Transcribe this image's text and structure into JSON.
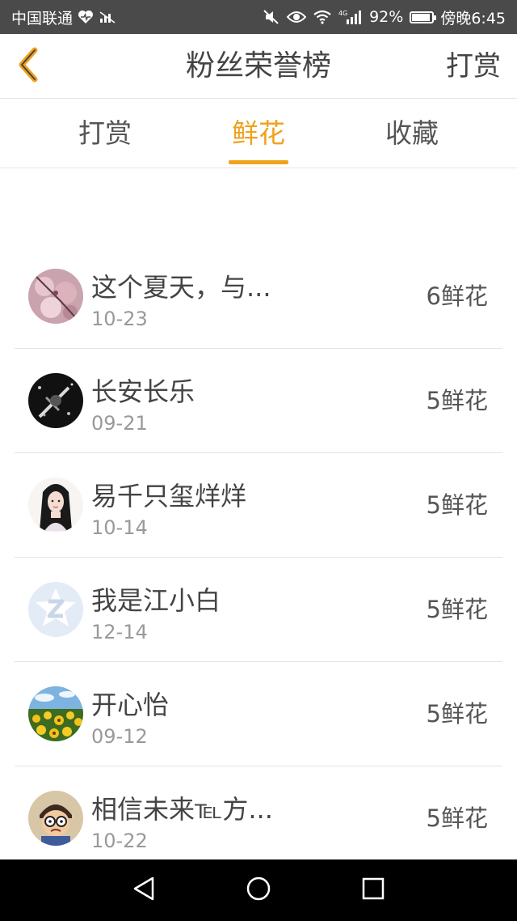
{
  "status_bar": {
    "carrier": "中国联通",
    "battery": "92%",
    "time": "傍晚6:45",
    "network": "4G",
    "battery_level": 0.92
  },
  "header": {
    "title": "粉丝荣誉榜",
    "action_label": "打赏"
  },
  "tabs": [
    {
      "label": "打赏",
      "active": false
    },
    {
      "label": "鲜花",
      "active": true
    },
    {
      "label": "收藏",
      "active": false
    }
  ],
  "fans": [
    {
      "name": "这个夏天，与...",
      "date": "10-23",
      "count": "6鲜花",
      "avatar": "cherry-blossom-avatar"
    },
    {
      "name": "长安长乐",
      "date": "09-21",
      "count": "5鲜花",
      "avatar": "dark-sword-avatar"
    },
    {
      "name": "易千只玺烊烊",
      "date": "10-14",
      "count": "5鲜花",
      "avatar": "girl-portrait-avatar"
    },
    {
      "name": "我是江小白",
      "date": "12-14",
      "count": "5鲜花",
      "avatar": "default-qq-avatar"
    },
    {
      "name": "开心怡",
      "date": "09-12",
      "count": "5鲜花",
      "avatar": "sunflower-field-avatar"
    },
    {
      "name": "相信未来℡方...",
      "date": "10-22",
      "count": "5鲜花",
      "avatar": "cartoon-nobita-avatar"
    }
  ],
  "colors": {
    "accent": "#f0a21c",
    "status_bar": "#4a4a4a",
    "nav_bar": "#000000"
  }
}
